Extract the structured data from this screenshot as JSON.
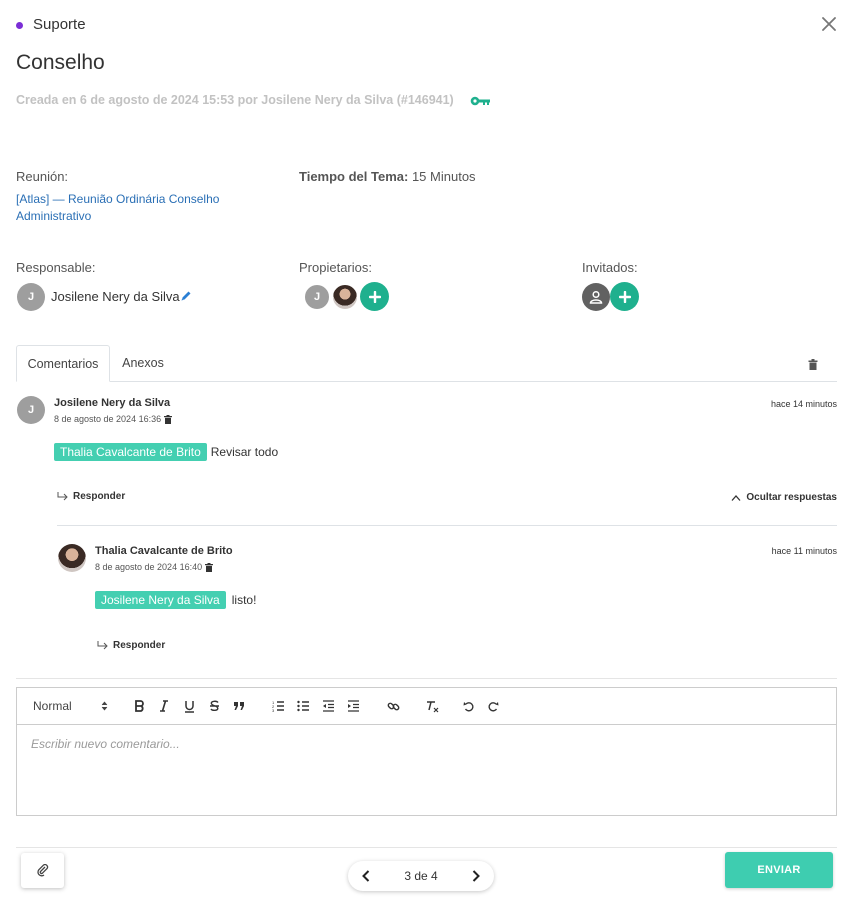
{
  "header": {
    "category": "Suporte",
    "category_color": "#7b2ed6",
    "title": "Conselho",
    "created": "Creada en 6 de agosto de 2024 15:53 por Josilene Nery da Silva (#146941)",
    "icon": "key-icon",
    "close_icon": "close-icon"
  },
  "meeting": {
    "label": "Reunión:",
    "link_line1": "[Atlas] — Reunião Ordinária Conselho",
    "link_line2": "Administrativo"
  },
  "time": {
    "label": "Tiempo del Tema:",
    "value": "15 Minutos"
  },
  "responsible": {
    "label": "Responsable:",
    "initial": "J",
    "name": "Josilene Nery da Silva"
  },
  "owners": {
    "label": "Propietarios:",
    "initial": "J"
  },
  "guests": {
    "label": "Invitados:"
  },
  "tabs": {
    "comments": "Comentarios",
    "attachments": "Anexos"
  },
  "comment1": {
    "initial": "J",
    "author": "Josilene Nery da Silva",
    "date": "8 de agosto de 2024 16:36",
    "relative": "hace 14 minutos",
    "mention": "Thalia Cavalcante de Brito",
    "text": "Revisar todo",
    "reply": "Responder",
    "hide_replies": "Ocultar respuestas"
  },
  "comment2": {
    "author": "Thalia Cavalcante de Brito",
    "date": "8 de agosto de 2024 16:40",
    "relative": "hace 11 minutos",
    "mention": "Josilene Nery da Silva",
    "text": "listo!",
    "reply": "Responder"
  },
  "editor": {
    "format": "Normal",
    "placeholder": "Escribir nuevo comentario..."
  },
  "footer": {
    "pager": "3 de 4",
    "send": "ENVIAR"
  },
  "colors": {
    "accent": "#1fb08e",
    "tag": "#44cfb1",
    "send": "#3ecdb0",
    "link": "#2a6fb5"
  }
}
